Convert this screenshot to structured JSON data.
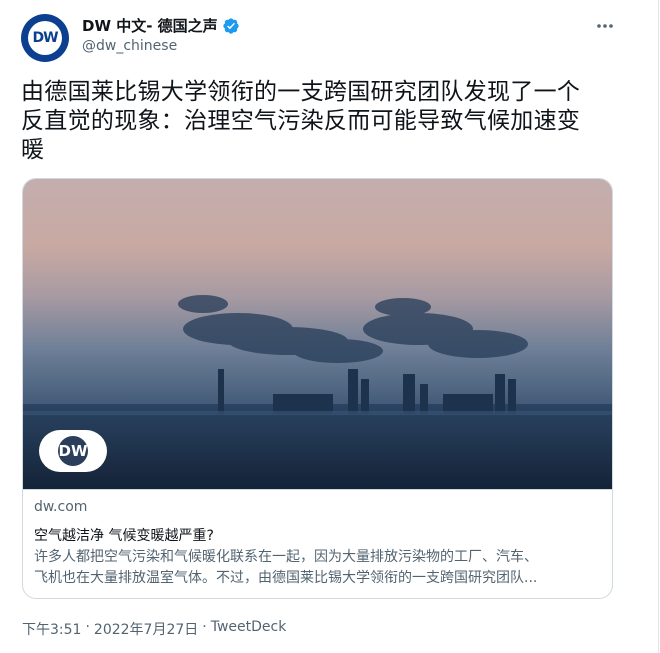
{
  "tweet": {
    "author": {
      "display_name": "DW 中文- 德国之声",
      "handle": "@dw_chinese",
      "avatar_text": "DW",
      "verified_icon": "verified-badge-icon",
      "verified_color": "#1d9bf0"
    },
    "text_lines": [
      "由德国莱比锡大学领衔的一支跨国研究团队发现了一个",
      "反直觉的现象：治理空气污染反而可能导致气候加速变",
      "暖"
    ],
    "card": {
      "image_logo_text": "DW",
      "domain": "dw.com",
      "title": "空气越洁净 气候变暖越严重?",
      "description_lines": [
        "许多人都把空气污染和气候暖化联系在一起，因为大量排放污染物的工厂、汽车、",
        "飞机也在大量排放温室气体。不过，由德国莱比锡大学领衔的一支跨国研究团队..."
      ]
    },
    "time": "下午3:51",
    "separator1": "·",
    "date": "2022年7月27日",
    "separator2": "·",
    "source": "TweetDeck"
  },
  "colors": {
    "text_primary": "#0f1419",
    "text_secondary": "#536471",
    "border": "#cfd9de",
    "dw_blue": "#0c3f8f"
  }
}
